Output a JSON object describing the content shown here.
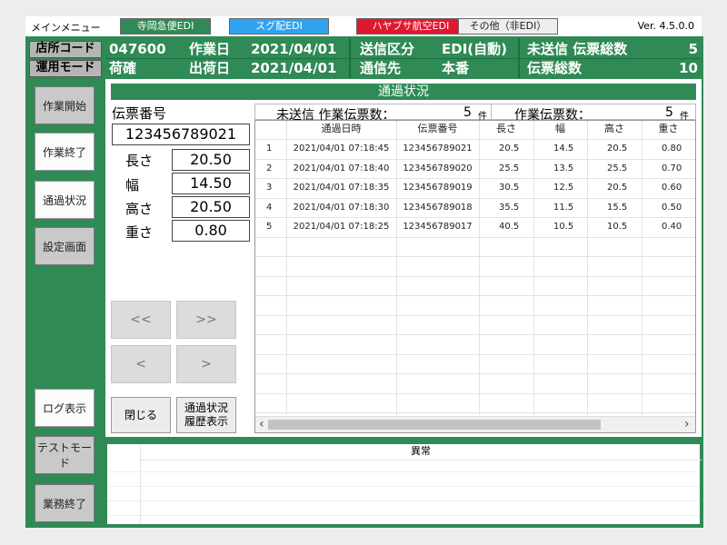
{
  "menubar": {
    "title": "メインメニュー",
    "tabs": [
      {
        "label": "寺岡急便EDI",
        "bg": "#2f8a55",
        "fg": "#ffffff"
      },
      {
        "label": "スグ配EDI",
        "bg": "#2fa3f0",
        "fg": "#ffffff"
      },
      {
        "label": "ハヤブサ航空EDI",
        "bg": "#e0182e",
        "fg": "#ffffff"
      },
      {
        "label": "その他（非EDI）",
        "bg": "#eeeeee",
        "fg": "#222222"
      }
    ],
    "version": "Ver. 4.5.0.0"
  },
  "header": {
    "shop_code_label": "店所コード",
    "shop_code": "047600",
    "work_date_label": "作業日",
    "work_date": "2021/04/01",
    "send_type_label": "送信区分",
    "send_type": "EDI(自動)",
    "unsent_label": "未送信 伝票総数",
    "unsent_count": "5",
    "mode_label": "運用モード",
    "mode": "荷確",
    "ship_date_label": "出荷日",
    "ship_date": "2021/04/01",
    "dest_label": "通信先",
    "dest": "本番",
    "total_label": "伝票総数",
    "total_count": "10"
  },
  "sidebar": {
    "start": "作業開始",
    "end": "作業終了",
    "pass_status": "通過状況",
    "settings": "設定画面",
    "log": "ログ表示",
    "test_mode": "テストモード",
    "business_end": "業務終了"
  },
  "main": {
    "status_title": "通過状況",
    "slip_no_label": "伝票番号",
    "slip_no": "123456789021",
    "length_label": "長さ",
    "length": "20.50",
    "width_label": "幅",
    "width": "14.50",
    "height_label": "高さ",
    "height": "20.50",
    "weight_label": "重さ",
    "weight": "0.80",
    "nav_first": "<<",
    "nav_last": ">>",
    "nav_prev": "<",
    "nav_next": ">",
    "close": "閉じる",
    "history_line1": "通過状況",
    "history_line2": "履歴表示",
    "unsent_summary_label": "未送信 作業伝票数：",
    "unsent_summary_count": "5",
    "work_summary_label": "作業伝票数：",
    "work_summary_count": "5",
    "unit": "件"
  },
  "table": {
    "columns": [
      "",
      "通過日時",
      "伝票番号",
      "長さ",
      "幅",
      "高さ",
      "重さ"
    ],
    "rows": [
      [
        "1",
        "2021/04/01 07:18:45",
        "123456789021",
        "20.5",
        "14.5",
        "20.5",
        "0.80"
      ],
      [
        "2",
        "2021/04/01 07:18:40",
        "123456789020",
        "25.5",
        "13.5",
        "25.5",
        "0.70"
      ],
      [
        "3",
        "2021/04/01 07:18:35",
        "123456789019",
        "30.5",
        "12.5",
        "20.5",
        "0.60"
      ],
      [
        "4",
        "2021/04/01 07:18:30",
        "123456789018",
        "35.5",
        "11.5",
        "15.5",
        "0.50"
      ],
      [
        "5",
        "2021/04/01 07:18:25",
        "123456789017",
        "40.5",
        "10.5",
        "10.5",
        "0.40"
      ]
    ],
    "scroll_left": "‹",
    "scroll_right": "›"
  },
  "error_panel": {
    "header": "異常"
  }
}
